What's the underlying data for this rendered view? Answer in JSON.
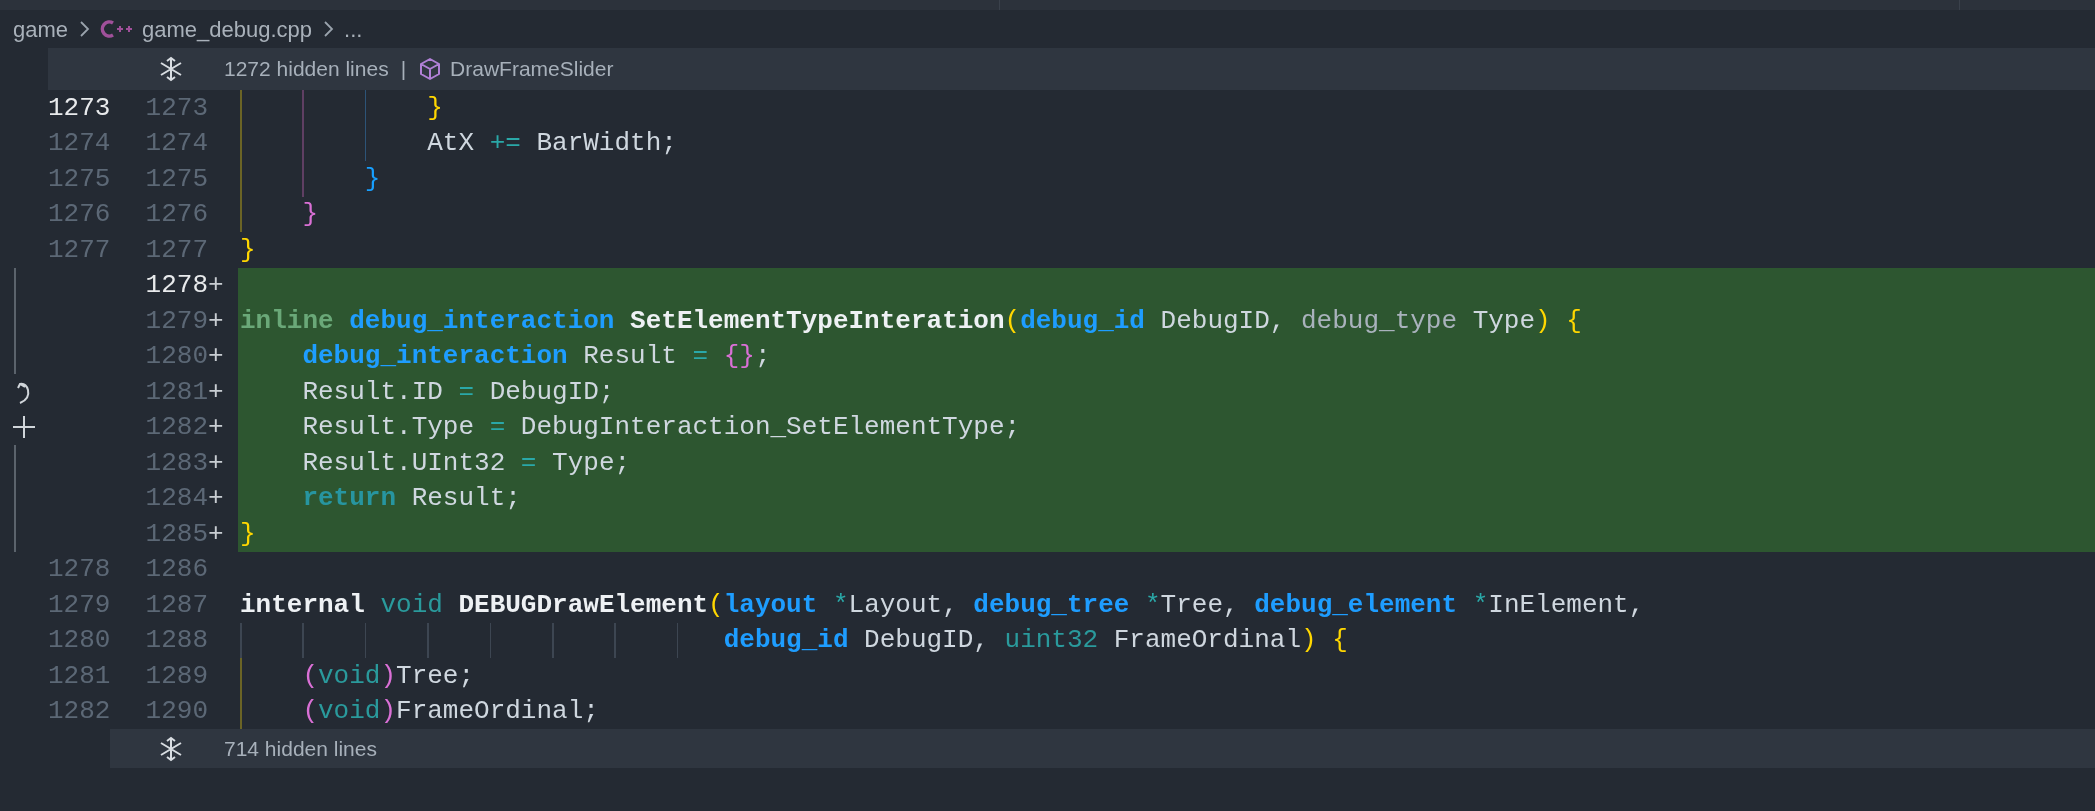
{
  "breadcrumb": [
    {
      "kind": "folder",
      "text": "game"
    },
    {
      "kind": "cpp-file",
      "text": "game_debug.cpp"
    },
    {
      "kind": "more",
      "text": "..."
    }
  ],
  "folds": [
    {
      "text": "1272 hidden lines",
      "separator": "|",
      "symbol": "DrawFrameSlider"
    },
    {
      "text": "714 hidden lines"
    }
  ],
  "lines": [
    {
      "old": {
        "text": "1273",
        "active": true
      },
      "new": {
        "text": "1273",
        "active": false
      },
      "added": false,
      "tokens": [
        {
          "kind": "bracket1",
          "text": "            }"
        }
      ]
    },
    {
      "old": {
        "text": "1274",
        "active": false
      },
      "new": {
        "text": "1274",
        "active": false
      },
      "added": false,
      "tokens": [
        {
          "kind": "plain",
          "text": "            AtX "
        },
        {
          "kind": "op",
          "text": "+="
        },
        {
          "kind": "plain",
          "text": " BarWidth;"
        }
      ]
    },
    {
      "old": {
        "text": "1275",
        "active": false
      },
      "new": {
        "text": "1275",
        "active": false
      },
      "added": false,
      "tokens": [
        {
          "kind": "bracket3",
          "text": "        }"
        }
      ]
    },
    {
      "old": {
        "text": "1276",
        "active": false
      },
      "new": {
        "text": "1276",
        "active": false
      },
      "added": false,
      "tokens": [
        {
          "kind": "bracket2",
          "text": "    }"
        }
      ]
    },
    {
      "old": {
        "text": "1277",
        "active": false
      },
      "new": {
        "text": "1277",
        "active": false
      },
      "added": false,
      "tokens": [
        {
          "kind": "bracket1",
          "text": "}"
        }
      ]
    },
    {
      "new": {
        "text": "1278",
        "active": true
      },
      "mark": "+",
      "added": true
    },
    {
      "new": {
        "text": "1279",
        "active": false
      },
      "mark": "+",
      "added": true,
      "tokens": [
        {
          "kind": "kw",
          "text": "inline "
        },
        {
          "kind": "type",
          "text": "debug_interaction "
        },
        {
          "kind": "func",
          "text": "SetElementTypeInteration"
        },
        {
          "kind": "bracket1",
          "text": "("
        },
        {
          "kind": "type",
          "text": "debug_id"
        },
        {
          "kind": "plain",
          "text": " DebugID, "
        },
        {
          "kind": "param",
          "text": "debug_type"
        },
        {
          "kind": "plain",
          "text": " Type"
        },
        {
          "kind": "bracket1",
          "text": ") {"
        }
      ]
    },
    {
      "new": {
        "text": "1280",
        "active": false
      },
      "mark": "+",
      "added": true,
      "tokens": [
        {
          "kind": "type",
          "text": "    debug_interaction"
        },
        {
          "kind": "plain",
          "text": " Result "
        },
        {
          "kind": "op",
          "text": "= "
        },
        {
          "kind": "bracket2",
          "text": "{}"
        },
        {
          "kind": "plain",
          "text": ";"
        }
      ]
    },
    {
      "new": {
        "text": "1281",
        "active": false
      },
      "mark": "+",
      "added": true,
      "tokens": [
        {
          "kind": "plain",
          "text": "    Result.ID "
        },
        {
          "kind": "op",
          "text": "="
        },
        {
          "kind": "plain",
          "text": " DebugID;"
        }
      ]
    },
    {
      "new": {
        "text": "1282",
        "active": false
      },
      "mark": "+",
      "added": true,
      "tokens": [
        {
          "kind": "plain",
          "text": "    Result.Type "
        },
        {
          "kind": "op",
          "text": "="
        },
        {
          "kind": "plain",
          "text": " DebugInteraction_SetElementType;"
        }
      ]
    },
    {
      "new": {
        "text": "1283",
        "active": false
      },
      "mark": "+",
      "added": true,
      "tokens": [
        {
          "kind": "plain",
          "text": "    Result.UInt32 "
        },
        {
          "kind": "op",
          "text": "="
        },
        {
          "kind": "plain",
          "text": " Type;"
        }
      ]
    },
    {
      "new": {
        "text": "1284",
        "active": false
      },
      "mark": "+",
      "added": true,
      "tokens": [
        {
          "kind": "ctrl",
          "text": "    return"
        },
        {
          "kind": "plain",
          "text": " Result;"
        }
      ]
    },
    {
      "new": {
        "text": "1285",
        "active": false
      },
      "mark": "+",
      "added": true,
      "tokens": [
        {
          "kind": "bracket1",
          "text": "}"
        }
      ]
    },
    {
      "old": {
        "text": "1278",
        "active": false
      },
      "new": {
        "text": "1286",
        "active": false
      },
      "added": false
    },
    {
      "old": {
        "text": "1279",
        "active": false
      },
      "new": {
        "text": "1287",
        "active": false
      },
      "added": false,
      "tokens": [
        {
          "kind": "func",
          "text": "internal "
        },
        {
          "kind": "void",
          "text": "void "
        },
        {
          "kind": "func",
          "text": "DEBUGDrawElement"
        },
        {
          "kind": "bracket1",
          "text": "("
        },
        {
          "kind": "type",
          "text": "layout "
        },
        {
          "kind": "op",
          "text": "*"
        },
        {
          "kind": "plain",
          "text": "Layout, "
        },
        {
          "kind": "type",
          "text": "debug_tree "
        },
        {
          "kind": "op",
          "text": "*"
        },
        {
          "kind": "plain",
          "text": "Tree, "
        },
        {
          "kind": "type",
          "text": "debug_element "
        },
        {
          "kind": "op",
          "text": "*"
        },
        {
          "kind": "plain",
          "text": "InElement,"
        }
      ]
    },
    {
      "old": {
        "text": "1280",
        "active": false
      },
      "new": {
        "text": "1288",
        "active": false
      },
      "added": false,
      "tokens": [
        {
          "kind": "type",
          "text": "                               debug_id"
        },
        {
          "kind": "plain",
          "text": " DebugID, "
        },
        {
          "kind": "void",
          "text": "uint32"
        },
        {
          "kind": "plain",
          "text": " FrameOrdinal"
        },
        {
          "kind": "bracket1",
          "text": ") {"
        }
      ]
    },
    {
      "old": {
        "text": "1281",
        "active": false
      },
      "new": {
        "text": "1289",
        "active": false
      },
      "added": false,
      "tokens": [
        {
          "kind": "bracket2",
          "text": "    ("
        },
        {
          "kind": "void",
          "text": "void"
        },
        {
          "kind": "bracket2",
          "text": ")"
        },
        {
          "kind": "plain",
          "text": "Tree;"
        }
      ]
    },
    {
      "old": {
        "text": "1282",
        "active": false
      },
      "new": {
        "text": "1290",
        "active": false
      },
      "added": false,
      "tokens": [
        {
          "kind": "bracket2",
          "text": "    ("
        },
        {
          "kind": "void",
          "text": "void"
        },
        {
          "kind": "bracket2",
          "text": ")"
        },
        {
          "kind": "plain",
          "text": "FrameOrdinal;"
        }
      ]
    }
  ]
}
